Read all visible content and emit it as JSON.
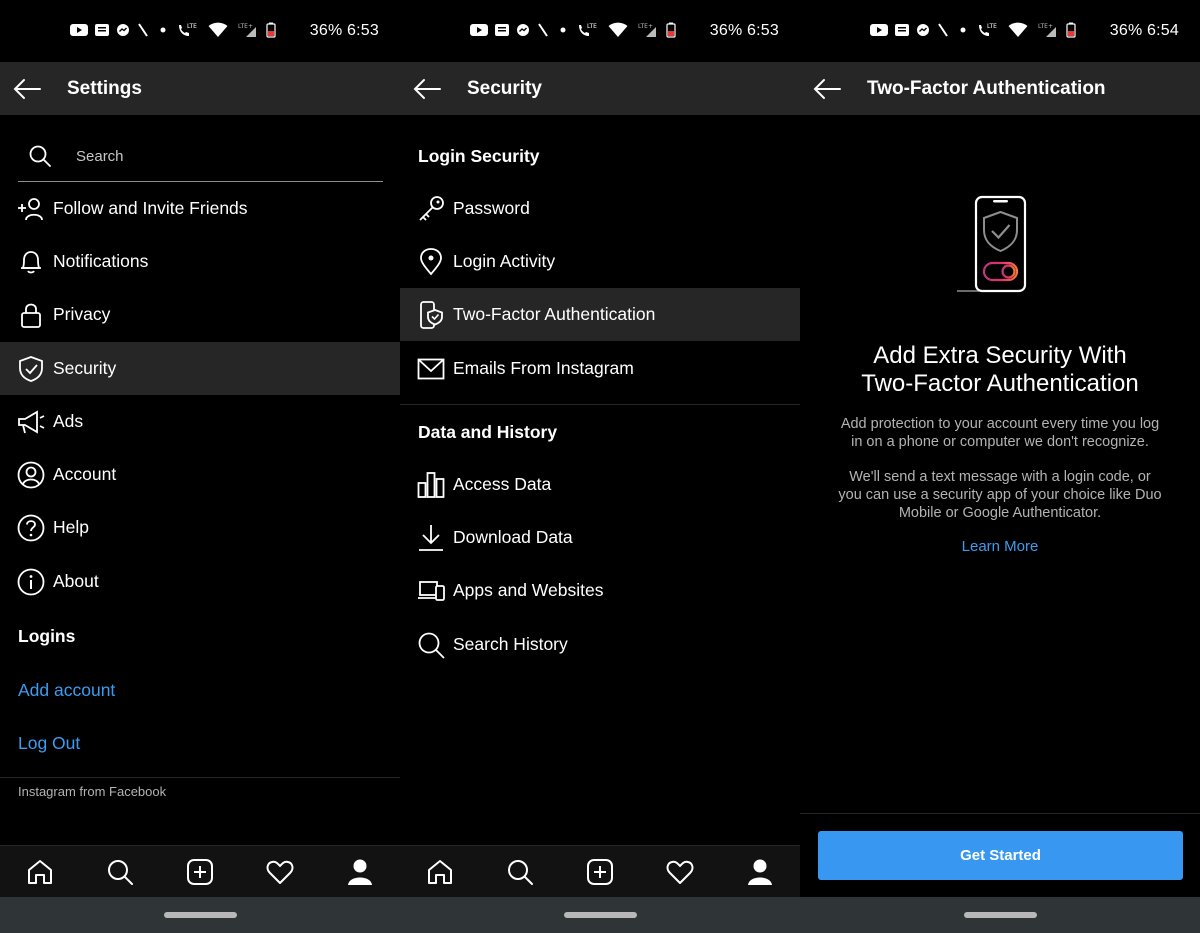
{
  "screens": [
    {
      "status": {
        "text": "36% 6:53"
      },
      "appbar": {
        "title": "Settings"
      },
      "search": {
        "placeholder": "Search"
      },
      "items": [
        {
          "label": "Follow and Invite Friends",
          "icon": "add-person-icon"
        },
        {
          "label": "Notifications",
          "icon": "bell-icon"
        },
        {
          "label": "Privacy",
          "icon": "lock-icon"
        },
        {
          "label": "Security",
          "icon": "shield-check-icon",
          "selected": true
        },
        {
          "label": "Ads",
          "icon": "megaphone-icon"
        },
        {
          "label": "Account",
          "icon": "user-circle-icon"
        },
        {
          "label": "Help",
          "icon": "help-circle-icon"
        },
        {
          "label": "About",
          "icon": "info-circle-icon"
        }
      ],
      "logins": {
        "heading": "Logins",
        "add_account": "Add account",
        "log_out": "Log Out"
      },
      "footer": "Instagram from Facebook"
    },
    {
      "status": {
        "text": "36% 6:53"
      },
      "appbar": {
        "title": "Security"
      },
      "sections": [
        {
          "heading": "Login Security",
          "items": [
            {
              "label": "Password",
              "icon": "key-icon"
            },
            {
              "label": "Login Activity",
              "icon": "location-pin-icon"
            },
            {
              "label": "Two-Factor Authentication",
              "icon": "phone-shield-icon",
              "selected": true
            },
            {
              "label": "Emails From Instagram",
              "icon": "envelope-icon"
            }
          ]
        },
        {
          "heading": "Data and History",
          "items": [
            {
              "label": "Access Data",
              "icon": "bar-chart-icon"
            },
            {
              "label": "Download Data",
              "icon": "download-icon"
            },
            {
              "label": "Apps and Websites",
              "icon": "laptop-phone-icon"
            },
            {
              "label": "Search History",
              "icon": "search-icon"
            }
          ]
        }
      ]
    },
    {
      "status": {
        "text": "36% 6:54"
      },
      "appbar": {
        "title": "Two-Factor Authentication"
      },
      "headline": [
        "Add Extra Security With",
        "Two-Factor Authentication"
      ],
      "body": [
        [
          "Add protection to your account every time you log",
          "in on a phone or computer we don't recognize."
        ],
        [
          "We'll send a text message with a login code, or",
          "you can use a security app of your choice like Duo",
          "Mobile or Google Authenticator."
        ]
      ],
      "learn_more": "Learn More",
      "cta": "Get Started"
    }
  ],
  "tabbar": [
    "home-icon",
    "search-icon",
    "new-post-icon",
    "heart-icon",
    "profile-icon"
  ],
  "colors": {
    "link": "#3d9bf0",
    "cta": "#3897f0",
    "bar": "#262626",
    "background": "#000000"
  }
}
